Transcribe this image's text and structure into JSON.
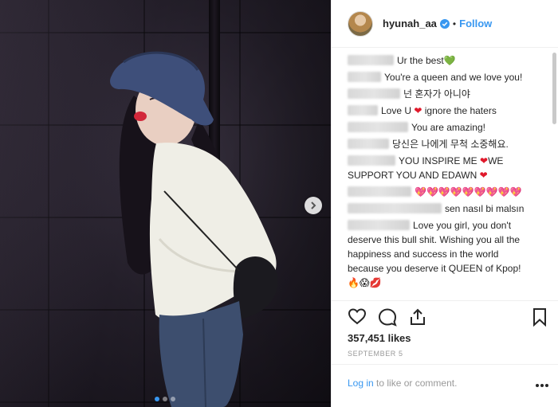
{
  "post": {
    "carousel": {
      "slide_count": 3,
      "active_index": 0
    }
  },
  "header": {
    "username": "hyunah_aa",
    "separator": "•",
    "follow_label": "Follow"
  },
  "comments": [
    {
      "parts": [
        {
          "t": "text",
          "v": "Ur the best"
        },
        {
          "t": "emoji",
          "v": "💚",
          "cls": "heart-green"
        }
      ]
    },
    {
      "parts": [
        {
          "t": "text",
          "v": "You're a queen and we love you!"
        }
      ]
    },
    {
      "parts": [
        {
          "t": "text",
          "v": "넌 혼자가 아니야"
        }
      ]
    },
    {
      "parts": [
        {
          "t": "text",
          "v": "Love U "
        },
        {
          "t": "emoji",
          "v": "❤",
          "cls": "heart-red"
        },
        {
          "t": "text",
          "v": " ignore the haters"
        }
      ]
    },
    {
      "parts": [
        {
          "t": "text",
          "v": "You are amazing!"
        }
      ]
    },
    {
      "parts": [
        {
          "t": "text",
          "v": "당신은 나에게 무척 소중해요."
        }
      ]
    },
    {
      "parts": [
        {
          "t": "text",
          "v": "YOU INSPIRE ME "
        },
        {
          "t": "emoji",
          "v": "❤",
          "cls": "heart-red"
        },
        {
          "t": "text",
          "v": "WE SUPPORT YOU AND EDAWN "
        },
        {
          "t": "emoji",
          "v": "❤",
          "cls": "heart-red"
        }
      ]
    },
    {
      "parts": [
        {
          "t": "emoji",
          "v": "💖💖💖💖💖💖💖💖💖",
          "cls": "heart-pink"
        }
      ]
    },
    {
      "parts": [
        {
          "t": "text",
          "v": "sen nasıl bi malsın"
        }
      ]
    },
    {
      "parts": [
        {
          "t": "text",
          "v": "Love you girl, you don't deserve this bull shit. Wishing you all the happiness and success in the world because you deserve it QUEEN of Kpop!"
        },
        {
          "t": "emoji",
          "v": " 🔥😱💋",
          "cls": ""
        }
      ]
    }
  ],
  "engagement": {
    "likes_text": "357,451 likes",
    "date_text": "SEPTEMBER 5"
  },
  "footer": {
    "login_link": "Log in",
    "login_rest": " to like or comment."
  },
  "icons": {
    "verified": "verified-badge-icon",
    "like": "heart-outline-icon",
    "comment": "comment-bubble-icon",
    "share": "share-upload-icon",
    "save": "bookmark-icon",
    "more": "more-options-icon",
    "next": "chevron-right-icon"
  },
  "colors": {
    "accent": "#3897f0",
    "text": "#262626",
    "muted": "#999999"
  }
}
